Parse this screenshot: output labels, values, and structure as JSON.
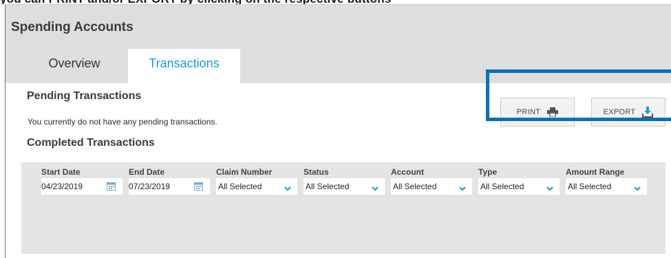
{
  "header": {
    "title": "Spending Accounts"
  },
  "tabs": [
    {
      "label": "Overview",
      "active": false
    },
    {
      "label": "Transactions",
      "active": true
    }
  ],
  "actions": {
    "print_label": "PRINT",
    "export_label": "EXPORT",
    "print_icon": "printer-icon",
    "export_icon": "download-icon"
  },
  "pending": {
    "title": "Pending Transactions",
    "message": "You currently do not have any pending transactions."
  },
  "completed": {
    "title": "Completed Transactions"
  },
  "filters": [
    {
      "label": "Start Date",
      "value": "04/23/2019",
      "kind": "date"
    },
    {
      "label": "End Date",
      "value": "07/23/2019",
      "kind": "date"
    },
    {
      "label": "Claim Number",
      "value": "All Selected",
      "kind": "select"
    },
    {
      "label": "Status",
      "value": "All Selected",
      "kind": "select"
    },
    {
      "label": "Account",
      "value": "All Selected",
      "kind": "select"
    },
    {
      "label": "Type",
      "value": "All Selected",
      "kind": "select"
    },
    {
      "label": "Amount Range",
      "value": "All Selected",
      "kind": "select"
    }
  ],
  "colors": {
    "accent": "#1a9bd7",
    "highlight_border": "#0b6fb8",
    "header_bg": "#dedede",
    "filter_bg": "#e4e4e4"
  }
}
